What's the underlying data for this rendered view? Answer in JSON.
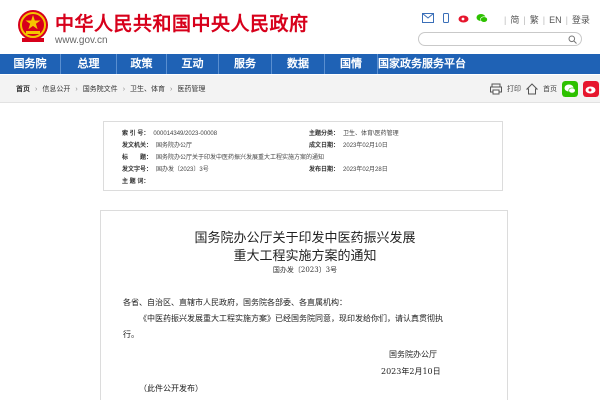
{
  "header": {
    "site_title": "中华人民共和国中央人民政府",
    "site_url": "www.gov.cn",
    "links": [
      "简",
      "繁",
      "EN",
      "登录"
    ],
    "search_placeholder": ""
  },
  "nav": {
    "items": [
      "国务院",
      "总理",
      "政策",
      "互动",
      "服务",
      "数据",
      "国情",
      "国家政务服务平台"
    ]
  },
  "breadcrumb": {
    "items": [
      "首页",
      "信息公开",
      "国务院文件",
      "卫生、体育",
      "医药管理"
    ],
    "tools": {
      "print": "打印",
      "home": "首页"
    }
  },
  "info": {
    "rows": [
      {
        "label": "索 引 号：",
        "value": "000014349/2023-00008"
      },
      {
        "label": "主题分类：",
        "value": "卫生、体育\\医药管理"
      },
      {
        "label": "发文机关：",
        "value": "国务院办公厅"
      },
      {
        "label": "成文日期：",
        "value": "2023年02月10日"
      },
      {
        "label": "标　　题：",
        "value": "国务院办公厅关于印发中医药振兴发展重大工程实施方案的通知"
      },
      {
        "label": "发文字号：",
        "value": "国办发〔2023〕3号"
      },
      {
        "label": "发布日期：",
        "value": "2023年02月28日"
      },
      {
        "label": "主 题 词：",
        "value": ""
      }
    ]
  },
  "document": {
    "title_line1": "国务院办公厅关于印发中医药振兴发展",
    "title_line2": "重大工程实施方案的通知",
    "number": "国办发〔2023〕3号",
    "salutation": "各省、自治区、直辖市人民政府，国务院各部委、各直属机构：",
    "body_line1": "《中医药振兴发展重大工程实施方案》已经国务院同意，现印发给你们，请认真贯彻执",
    "body_line2": "行。",
    "signer": "国务院办公厅",
    "date": "2023年2月10日",
    "note": "（此件公开发布）"
  },
  "colors": {
    "brand_red": "#d7001b",
    "nav_blue": "#1f62b5"
  }
}
